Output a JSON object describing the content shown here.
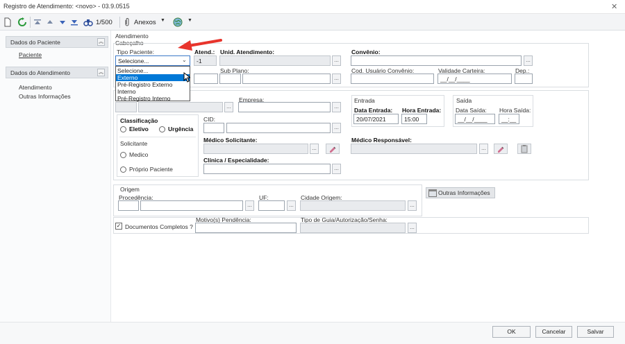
{
  "window": {
    "title": "Registro de Atendimento: <novo> - 03.9.0515",
    "close_glyph": "✕"
  },
  "toolbar": {
    "record_counter": "1/500",
    "attachments_label": "Anexos"
  },
  "nav": {
    "section_patient": "Dados do Paciente",
    "patient_link": "Paciente",
    "section_attendance": "Dados do Atendimento",
    "attendance_link": "Atendimento",
    "other_info_link": "Outras Informações"
  },
  "form": {
    "section_title": "Atendimento",
    "header_title": "Cabeçalho",
    "tipo_paciente_label": "Tipo Paciente:",
    "tipo_paciente_value": "Selecione...",
    "tipo_paciente_options": [
      "Selecione...",
      "Externo",
      "Pré-Registro Externo",
      "Interno",
      "Pré-Registro Interno"
    ],
    "tipo_paciente_highlighted": "Externo",
    "atend_label": "Atend.:",
    "atend_value": "-1",
    "unid_label": "Unid. Atendimento:",
    "convenio_label": "Convênio:",
    "sub_plano_label": "Sub Plano:",
    "cod_usuario_label": "Cod. Usuário Convênio:",
    "validade_label": "Validade Carteira:",
    "validade_value": "__/__/____",
    "dep_label": "Dep.:",
    "empresa_label": "Empresa:",
    "entrada_group": "Entrada",
    "data_entrada_label": "Data Entrada:",
    "data_entrada_value": "20/07/2021",
    "hora_entrada_label": "Hora Entrada:",
    "hora_entrada_value": "15:00",
    "saida_group": "Saída",
    "data_saida_label": "Data Saída:",
    "data_saida_value": "__/__/____",
    "hora_saida_label": "Hora Saída:",
    "hora_saida_value": "__:__",
    "classificacao_label": "Classificação",
    "eletivo_label": "Eletivo",
    "urgencia_label": "Urgência",
    "solicitante_label": "Solicitante",
    "medico_label": "Medico",
    "proprio_paciente_label": "Próprio Paciente",
    "cid_label": "CID:",
    "medico_solicitante_label": "Médico Solicitante:",
    "medico_responsavel_label": "Médico Responsável:",
    "clinica_label": "Clínica / Especialidade:",
    "origem_group": "Origem",
    "procedencia_label": "Procedência:",
    "uf_label": "UF:",
    "cidade_origem_label": "Cidade Origem:",
    "outras_info_button": "Outras Informações",
    "documentos_label": "Documentos Completos ?",
    "motivo_label": "Motivo(s) Pendência:",
    "tipo_guia_label": "Tipo de Guia/Autorização/Senha:",
    "ellipsis": "..."
  },
  "footer": {
    "ok_label": "OK",
    "cancel_label": "Cancelar",
    "save_label": "Salvar"
  },
  "colors": {
    "highlight": "#0078d7",
    "arrow": "#e8342c",
    "panel": "#e3e6ea"
  }
}
